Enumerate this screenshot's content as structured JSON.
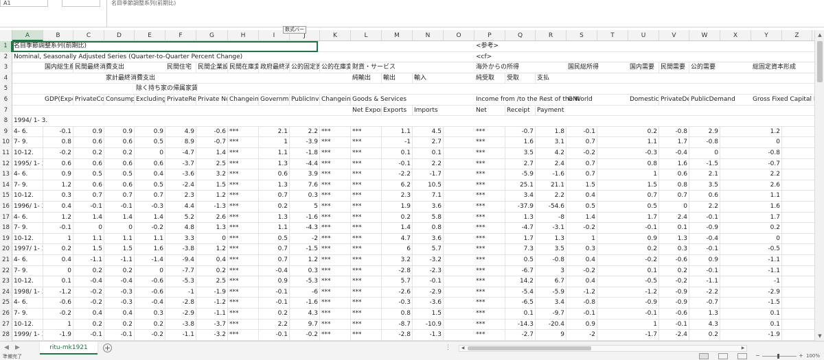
{
  "formula_bar": {
    "name_box": "A1",
    "formula": "名目季節調整系列(前期比)",
    "tooltip": "数式バー"
  },
  "columns": [
    "A",
    "B",
    "C",
    "D",
    "E",
    "F",
    "G",
    "H",
    "I",
    "J",
    "K",
    "L",
    "M",
    "N",
    "O",
    "P",
    "Q",
    "R",
    "S",
    "T",
    "U",
    "V",
    "W",
    "X",
    "Y",
    "Z"
  ],
  "rows": [
    {
      "n": "1",
      "c": {
        "A": "名目季節調整系列(前期比)",
        "P": "<参考>"
      }
    },
    {
      "n": "2",
      "c": {
        "A": "Nominal, Seasonally Adjusted Series (Quarter-to-Quarter Percent Change)",
        "P": "<cf>"
      }
    },
    {
      "n": "3",
      "c": {
        "B": "国内総生産",
        "C": "民間最終消費支出",
        "F": "民間住宅",
        "G": "民間企業設備",
        "H": "民間在庫変動",
        "I": "政府最終消費支出",
        "J": "公的固定資本形成",
        "K": "公的在庫変動",
        "L": "財貨・サービス",
        "P": "海外からの所得",
        "S": "国民総所得",
        "U": "国内需要",
        "V": "民間需要",
        "W": "公的需要",
        "Y": "総固定資本形成"
      }
    },
    {
      "n": "4",
      "c": {
        "D": "家計最終消費支出",
        "L": "純輸出",
        "M": "輸出",
        "N": "輸入",
        "P": "純受取",
        "Q": "受取",
        "R": "支払"
      }
    },
    {
      "n": "5",
      "c": {
        "E": "除く持ち家の帰属家賃"
      }
    },
    {
      "n": "6",
      "c": {
        "B": "GDP(Expenditure Approach)",
        "C": "PrivateConsumption",
        "D": "Consumption of Households",
        "E": "Excluding Imputed Rent",
        "F": "PrivateResidentialInvestment",
        "G": "Private Non-Resi. Investment",
        "H": "Changein Private Inventories",
        "I": "Government Consumption",
        "J": "PublicInvestment",
        "K": "Changein Public Inventories",
        "L": "Goods & Services",
        "P": "Income from /to the Rest of the World",
        "S": "GNI",
        "U": "DomesticDemand",
        "V": "PrivateDemand",
        "W": "PublicDemand",
        "Y": "Gross Fixed Capital Formation"
      }
    },
    {
      "n": "7",
      "c": {
        "L": "Net Exports",
        "M": "Exports",
        "N": "Imports",
        "P": "Net",
        "Q": "Receipt",
        "R": "Payment"
      }
    },
    {
      "n": "8",
      "c": {
        "A": "1994/ 1- 3."
      }
    },
    {
      "n": "9",
      "c": {
        "A": "4- 6.",
        "B": "-0.1",
        "C": "0.9",
        "D": "0.9",
        "E": "0.9",
        "F": "4.9",
        "G": "-0.6",
        "H": "***",
        "I": "2.1",
        "J": "2.2",
        "K": "***",
        "L": "***",
        "M": "1.1",
        "N": "4.5",
        "P": "***",
        "Q": "-0.7",
        "R": "1.8",
        "S": "-0.1",
        "U": "0.2",
        "V": "-0.8",
        "W": "2.9",
        "Y": "1.2"
      }
    },
    {
      "n": "10",
      "c": {
        "A": "7- 9.",
        "B": "0.8",
        "C": "0.6",
        "D": "0.6",
        "E": "0.5",
        "F": "8.9",
        "G": "-0.7",
        "H": "***",
        "I": "1",
        "J": "-3.9",
        "K": "***",
        "L": "***",
        "M": "-1",
        "N": "2.7",
        "P": "***",
        "Q": "1.6",
        "R": "3.1",
        "S": "0.7",
        "U": "1.1",
        "V": "1.7",
        "W": "-0.8",
        "Y": "0"
      }
    },
    {
      "n": "11",
      "c": {
        "A": "10-12.",
        "B": "-0.2",
        "C": "0.2",
        "D": "0.2",
        "E": "0",
        "F": "-4.7",
        "G": "1.4",
        "H": "***",
        "I": "1.1",
        "J": "-1.8",
        "K": "***",
        "L": "***",
        "M": "0.1",
        "N": "0.1",
        "P": "***",
        "Q": "3.5",
        "R": "4.2",
        "S": "-0.2",
        "U": "-0.3",
        "V": "-0.4",
        "W": "0",
        "Y": "-0.8"
      }
    },
    {
      "n": "12",
      "c": {
        "A": "1995/ 1- 3.",
        "B": "0.6",
        "C": "0.6",
        "D": "0.6",
        "E": "0.6",
        "F": "-3.7",
        "G": "2.5",
        "H": "***",
        "I": "1.3",
        "J": "-4.4",
        "K": "***",
        "L": "***",
        "M": "-0.1",
        "N": "2.2",
        "P": "***",
        "Q": "2.7",
        "R": "2.4",
        "S": "0.7",
        "U": "0.8",
        "V": "1.6",
        "W": "-1.5",
        "Y": "-0.7"
      }
    },
    {
      "n": "13",
      "c": {
        "A": "4- 6.",
        "B": "0.9",
        "C": "0.5",
        "D": "0.5",
        "E": "0.4",
        "F": "-3.6",
        "G": "3.2",
        "H": "***",
        "I": "0.6",
        "J": "3.9",
        "K": "***",
        "L": "***",
        "M": "-2.2",
        "N": "-1.7",
        "P": "***",
        "Q": "-5.9",
        "R": "-1.6",
        "S": "0.7",
        "U": "1",
        "V": "0.6",
        "W": "2.1",
        "Y": "2.2"
      }
    },
    {
      "n": "14",
      "c": {
        "A": "7- 9.",
        "B": "1.2",
        "C": "0.6",
        "D": "0.6",
        "E": "0.5",
        "F": "-2.4",
        "G": "1.5",
        "H": "***",
        "I": "1.3",
        "J": "7.6",
        "K": "***",
        "L": "***",
        "M": "6.2",
        "N": "10.5",
        "P": "***",
        "Q": "25.1",
        "R": "21.1",
        "S": "1.5",
        "U": "1.5",
        "V": "0.8",
        "W": "3.5",
        "Y": "2.6"
      }
    },
    {
      "n": "15",
      "c": {
        "A": "10-12.",
        "B": "0.3",
        "C": "0.7",
        "D": "0.7",
        "E": "0.7",
        "F": "2.3",
        "G": "1.2",
        "H": "***",
        "I": "0.7",
        "J": "0.3",
        "K": "***",
        "L": "***",
        "M": "2.3",
        "N": "7.1",
        "P": "***",
        "Q": "3.4",
        "R": "2.2",
        "S": "0.4",
        "U": "0.7",
        "V": "0.7",
        "W": "0.6",
        "Y": "1.1"
      }
    },
    {
      "n": "16",
      "c": {
        "A": "1996/ 1- 3.",
        "B": "0.4",
        "C": "-0.1",
        "D": "-0.1",
        "E": "-0.3",
        "F": "4.4",
        "G": "-1.3",
        "H": "***",
        "I": "0.2",
        "J": "5",
        "K": "***",
        "L": "***",
        "M": "1.9",
        "N": "3.6",
        "P": "***",
        "Q": "-37.9",
        "R": "-54.6",
        "S": "0.5",
        "U": "0.5",
        "V": "0",
        "W": "2.2",
        "Y": "1.6"
      }
    },
    {
      "n": "17",
      "c": {
        "A": "4- 6.",
        "B": "1.2",
        "C": "1.4",
        "D": "1.4",
        "E": "1.4",
        "F": "5.2",
        "G": "2.6",
        "H": "***",
        "I": "1.3",
        "J": "-1.6",
        "K": "***",
        "L": "***",
        "M": "0.2",
        "N": "5.8",
        "P": "***",
        "Q": "1.3",
        "R": "-8",
        "S": "1.4",
        "U": "1.7",
        "V": "2.4",
        "W": "-0.1",
        "Y": "1.7"
      }
    },
    {
      "n": "18",
      "c": {
        "A": "7- 9.",
        "B": "-0.1",
        "C": "0",
        "D": "0",
        "E": "-0.2",
        "F": "4.8",
        "G": "1.3",
        "H": "***",
        "I": "1.1",
        "J": "-4.3",
        "K": "***",
        "L": "***",
        "M": "1.4",
        "N": "0.8",
        "P": "***",
        "Q": "-4.7",
        "R": "-3.1",
        "S": "-0.2",
        "U": "-0.1",
        "V": "0.1",
        "W": "-0.9",
        "Y": "0.2"
      }
    },
    {
      "n": "19",
      "c": {
        "A": "10-12.",
        "B": "1",
        "C": "1.1",
        "D": "1.1",
        "E": "1.1",
        "F": "3.3",
        "G": "0",
        "H": "***",
        "I": "0.5",
        "J": "-2",
        "K": "***",
        "L": "***",
        "M": "4.7",
        "N": "3.6",
        "P": "***",
        "Q": "1.7",
        "R": "1.3",
        "S": "1",
        "U": "0.9",
        "V": "1.3",
        "W": "-0.4",
        "Y": "0"
      }
    },
    {
      "n": "20",
      "c": {
        "A": "1997/ 1- 3.",
        "B": "0.2",
        "C": "1.5",
        "D": "1.5",
        "E": "1.6",
        "F": "-3.8",
        "G": "1.2",
        "H": "***",
        "I": "0.7",
        "J": "-1.5",
        "K": "***",
        "L": "***",
        "M": "6",
        "N": "5.7",
        "P": "***",
        "Q": "7.3",
        "R": "3.5",
        "S": "0.3",
        "U": "0.2",
        "V": "0.3",
        "W": "-0.1",
        "Y": "-0.5"
      }
    },
    {
      "n": "21",
      "c": {
        "A": "4- 6.",
        "B": "0.4",
        "C": "-1.1",
        "D": "-1.1",
        "E": "-1.4",
        "F": "-9.4",
        "G": "0.4",
        "H": "***",
        "I": "0.7",
        "J": "1.2",
        "K": "***",
        "L": "***",
        "M": "3.2",
        "N": "-3.2",
        "P": "***",
        "Q": "0.5",
        "R": "-0.8",
        "S": "0.4",
        "U": "-0.2",
        "V": "-0.6",
        "W": "0.9",
        "Y": "-1.1"
      }
    },
    {
      "n": "22",
      "c": {
        "A": "7- 9.",
        "B": "0",
        "C": "0.2",
        "D": "0.2",
        "E": "0",
        "F": "-7.7",
        "G": "0.2",
        "H": "***",
        "I": "-0.4",
        "J": "0.3",
        "K": "***",
        "L": "***",
        "M": "-2.8",
        "N": "-2.3",
        "P": "***",
        "Q": "-6.7",
        "R": "3",
        "S": "-0.2",
        "U": "0.1",
        "V": "0.2",
        "W": "-0.1",
        "Y": "-1.1"
      }
    },
    {
      "n": "23",
      "c": {
        "A": "10-12.",
        "B": "0.1",
        "C": "-0.4",
        "D": "-0.4",
        "E": "-0.6",
        "F": "-5.3",
        "G": "2.5",
        "H": "***",
        "I": "0.9",
        "J": "-5.3",
        "K": "***",
        "L": "***",
        "M": "5.7",
        "N": "-0.1",
        "P": "***",
        "Q": "14.2",
        "R": "6.7",
        "S": "0.4",
        "U": "-0.5",
        "V": "-0.2",
        "W": "-1.1",
        "Y": "-1"
      }
    },
    {
      "n": "24",
      "c": {
        "A": "1998/ 1- 3.",
        "B": "-1.2",
        "C": "-0.2",
        "D": "-0.3",
        "E": "-0.6",
        "F": "-1",
        "G": "-1.9",
        "H": "***",
        "I": "-0.1",
        "J": "-6",
        "K": "***",
        "L": "***",
        "M": "-2.6",
        "N": "-2.9",
        "P": "***",
        "Q": "-5.4",
        "R": "-5.9",
        "S": "-1.2",
        "U": "-1.2",
        "V": "-0.9",
        "W": "-2.2",
        "Y": "-2.9"
      }
    },
    {
      "n": "25",
      "c": {
        "A": "4- 6.",
        "B": "-0.6",
        "C": "-0.2",
        "D": "-0.3",
        "E": "-0.4",
        "F": "-2.8",
        "G": "-1.2",
        "H": "***",
        "I": "-0.1",
        "J": "-1.6",
        "K": "***",
        "L": "***",
        "M": "-0.3",
        "N": "-3.6",
        "P": "***",
        "Q": "-6.5",
        "R": "3.4",
        "S": "-0.8",
        "U": "-0.9",
        "V": "-0.9",
        "W": "-0.7",
        "Y": "-1.5"
      }
    },
    {
      "n": "26",
      "c": {
        "A": "7- 9.",
        "B": "-0.2",
        "C": "0.4",
        "D": "0.4",
        "E": "0.3",
        "F": "-2.9",
        "G": "-1.1",
        "H": "***",
        "I": "0.2",
        "J": "4.3",
        "K": "***",
        "L": "***",
        "M": "0.8",
        "N": "1.5",
        "P": "***",
        "Q": "0.1",
        "R": "-9.7",
        "S": "-0.1",
        "U": "-0.1",
        "V": "-0.6",
        "W": "1.3",
        "Y": "0.1"
      }
    },
    {
      "n": "27",
      "c": {
        "A": "10-12.",
        "B": "1",
        "C": "0.2",
        "D": "0.2",
        "E": "0.2",
        "F": "-3.8",
        "G": "-3.7",
        "H": "***",
        "I": "2.2",
        "J": "9.7",
        "K": "***",
        "L": "***",
        "M": "-8.7",
        "N": "-10.9",
        "P": "***",
        "Q": "-14.3",
        "R": "-20.4",
        "S": "0.9",
        "U": "1",
        "V": "-0.1",
        "W": "4.3",
        "Y": "0.1"
      }
    },
    {
      "n": "28",
      "c": {
        "A": "1999/ 1- 3.",
        "B": "-1.9",
        "C": "-0.1",
        "D": "-0.1",
        "E": "-0.2",
        "F": "-1.1",
        "G": "-3.2",
        "H": "***",
        "I": "-0.1",
        "J": "-0.2",
        "K": "***",
        "L": "***",
        "M": "-2.8",
        "N": "-1.3",
        "P": "***",
        "Q": "-2.7",
        "R": "9",
        "S": "-2",
        "U": "-1.7",
        "V": "-2.4",
        "W": "0.2",
        "Y": "-1.9"
      }
    }
  ],
  "sheet_tabs": {
    "active": "ritu-mk1921",
    "add_label": "+",
    "dots": "⋮"
  },
  "status": {
    "text": "準備完了",
    "zoom": "100%"
  }
}
